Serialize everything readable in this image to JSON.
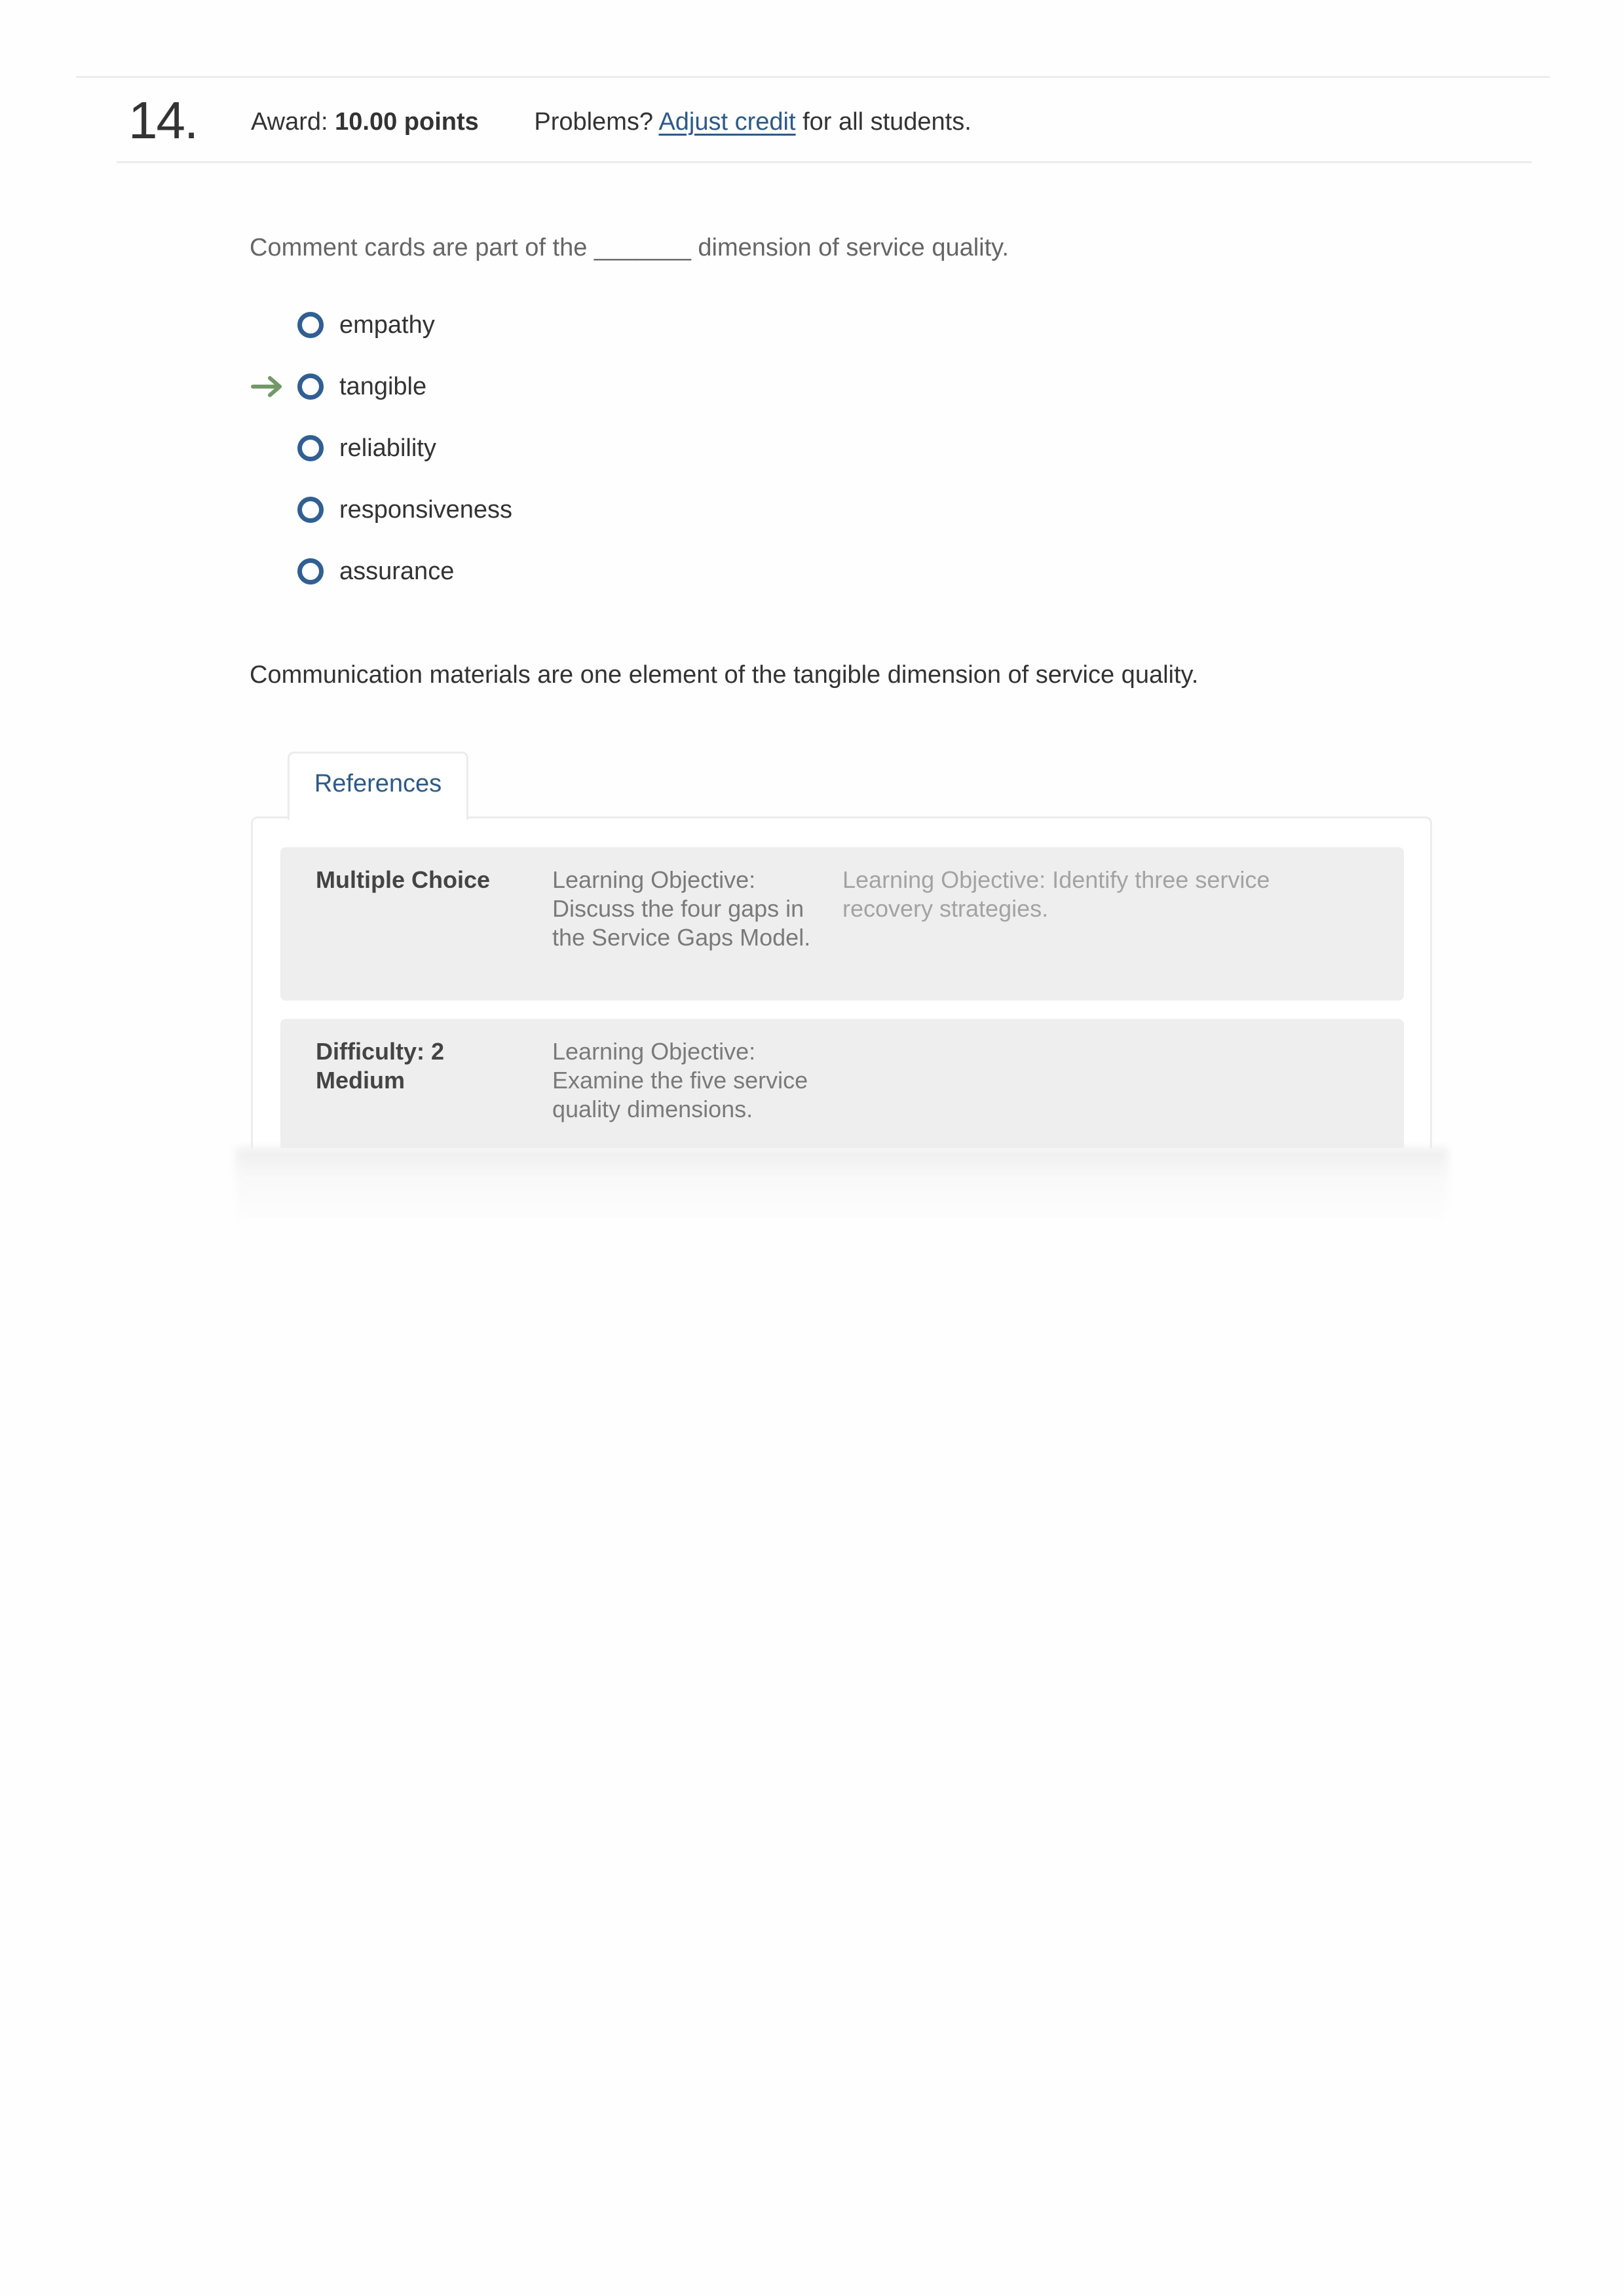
{
  "question": {
    "number": "14.",
    "award_label": "Award: ",
    "award_value": "10.00 points",
    "problems_prefix": "Problems? ",
    "adjust_credit_link": "Adjust credit",
    "problems_suffix": " for all students.",
    "prompt": "Comment cards are part of the _______ dimension of service quality.",
    "options": [
      {
        "label": "empathy",
        "correct": false
      },
      {
        "label": "tangible",
        "correct": true
      },
      {
        "label": "reliability",
        "correct": false
      },
      {
        "label": "responsiveness",
        "correct": false
      },
      {
        "label": "assurance",
        "correct": false
      }
    ],
    "correct_indicator_icon": "arrow-right-icon",
    "explanation": "Communication materials are one element of the tangible dimension of service quality."
  },
  "references": {
    "tab_label": "References",
    "rows": [
      {
        "col1": "Multiple Choice",
        "col2": "Learning Objective: Discuss the four gaps in the Service Gaps Model.",
        "col3": "Learning Objective: Identify three service recovery strategies."
      },
      {
        "col1": "Difficulty: 2 Medium",
        "col2": "Learning Objective: Examine the five service quality dimensions.",
        "col3": ""
      }
    ]
  },
  "colors": {
    "link": "#2a5b8f",
    "radio": "#2e6096",
    "correct_arrow": "#6f9a66",
    "reference_row_bg": "#eeeeee"
  }
}
